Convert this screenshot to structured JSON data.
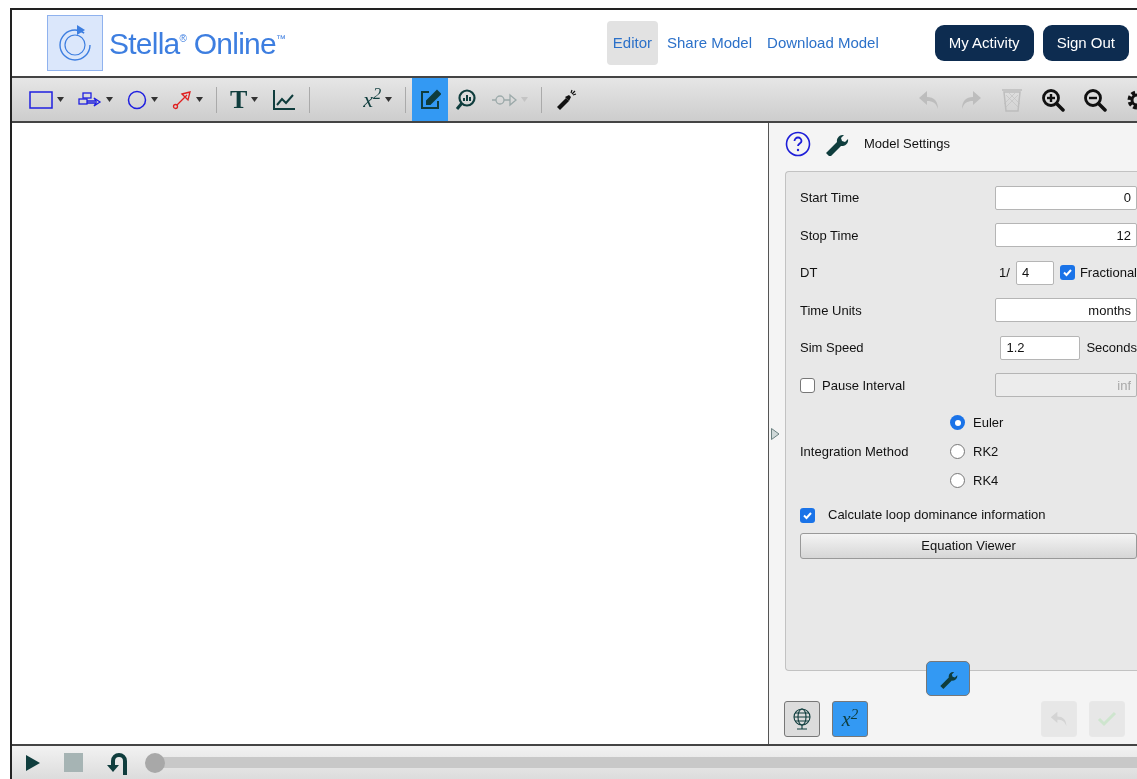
{
  "header": {
    "logo_text": "Stella$^{®}$ Online$^{™}$",
    "nav": [
      {
        "label": "Editor",
        "selected": true
      },
      {
        "label": "Share Model",
        "selected": false
      },
      {
        "label": "Download Model",
        "selected": false
      }
    ],
    "buttons": [
      "My Activity",
      "Sign Out"
    ]
  },
  "toolbar": {
    "tools": [
      {
        "kind": "stock",
        "has_menu": true,
        "selected": false,
        "disabled": false
      },
      {
        "kind": "flow",
        "has_menu": true,
        "selected": false,
        "disabled": false
      },
      {
        "kind": "converter",
        "has_menu": true,
        "selected": false,
        "disabled": false
      },
      {
        "kind": "connector",
        "has_menu": true,
        "selected": false,
        "disabled": false
      },
      {
        "kind": "text",
        "label": "T",
        "has_menu": true,
        "selected": false,
        "disabled": false
      },
      {
        "kind": "graph",
        "has_menu": false,
        "selected": false,
        "disabled": false
      },
      {
        "kind": "equation",
        "label": "x$^{2}$",
        "has_menu": true,
        "selected": false,
        "disabled": false
      },
      {
        "kind": "edit",
        "has_menu": false,
        "selected": true,
        "disabled": false
      },
      {
        "kind": "analysis",
        "has_menu": false,
        "selected": false,
        "disabled": false
      },
      {
        "kind": "causal",
        "has_menu": true,
        "selected": false,
        "disabled": true
      },
      {
        "kind": "flashlight",
        "has_menu": false,
        "selected": false,
        "disabled": false
      }
    ],
    "actions": [
      {
        "kind": "undo",
        "disabled": true
      },
      {
        "kind": "redo",
        "disabled": true
      },
      {
        "kind": "trash",
        "disabled": true
      },
      {
        "kind": "zoom-in",
        "disabled": false
      },
      {
        "kind": "zoom-out",
        "disabled": false
      },
      {
        "kind": "settings",
        "disabled": false
      }
    ]
  },
  "panel": {
    "title": "Model Settings",
    "start_time": {
      "label": "Start Time",
      "value": "0"
    },
    "stop_time": {
      "label": "Stop Time",
      "value": "12"
    },
    "dt": {
      "label": "DT",
      "prefix": "1/",
      "value": "4",
      "fractional_label": "Fractional",
      "fractional_checked": true
    },
    "time_units": {
      "label": "Time Units",
      "value": "months"
    },
    "sim_speed": {
      "label": "Sim Speed",
      "value": "1.2",
      "suffix": "Seconds"
    },
    "pause": {
      "label": "Pause Interval",
      "checked": false,
      "value": "inf"
    },
    "integration": {
      "label": "Integration Method",
      "options": [
        {
          "label": "Euler",
          "selected": true
        },
        {
          "label": "RK2",
          "selected": false
        },
        {
          "label": "RK4",
          "selected": false
        }
      ]
    },
    "loop_dominance": {
      "label": "Calculate loop dominance information",
      "checked": true
    },
    "equation_button": "Equation Viewer",
    "bottom": [
      {
        "kind": "globe",
        "selected": false,
        "disabled": false
      },
      {
        "kind": "equation",
        "label": "x$^{2}$",
        "selected": true,
        "disabled": false
      },
      {
        "kind": "undo",
        "selected": false,
        "disabled": true
      },
      {
        "kind": "check",
        "selected": false,
        "disabled": true
      }
    ],
    "settings_tab": {
      "selected": true
    }
  },
  "playback": {
    "play_disabled": false,
    "stop_disabled": true,
    "slider": {
      "level": 0
    }
  }
}
